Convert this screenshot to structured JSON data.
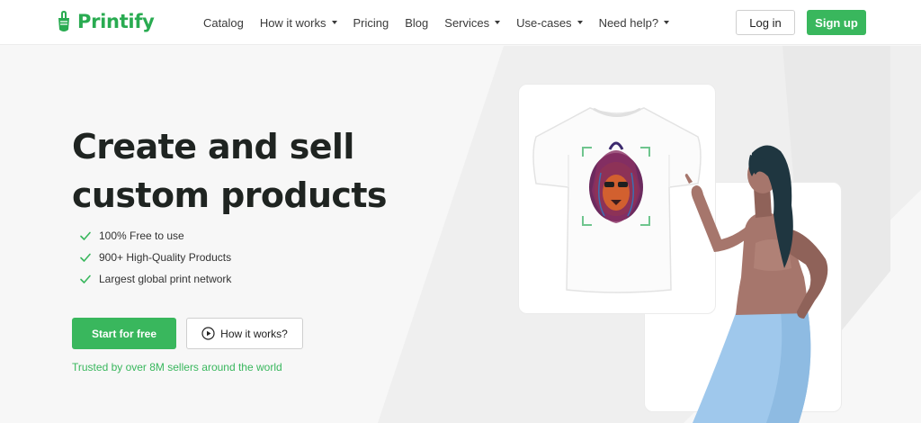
{
  "brand": {
    "name": "Printify",
    "color": "#29ab51"
  },
  "nav": {
    "items": [
      {
        "label": "Catalog",
        "dropdown": false
      },
      {
        "label": "How it works",
        "dropdown": true
      },
      {
        "label": "Pricing",
        "dropdown": false
      },
      {
        "label": "Blog",
        "dropdown": false
      },
      {
        "label": "Services",
        "dropdown": true
      },
      {
        "label": "Use-cases",
        "dropdown": true
      },
      {
        "label": "Need help?",
        "dropdown": true
      }
    ]
  },
  "auth": {
    "login_label": "Log in",
    "signup_label": "Sign up"
  },
  "hero": {
    "headline_line1": "Create and sell",
    "headline_line2": "custom products",
    "features": [
      "100% Free to use",
      "900+ High-Quality Products",
      "Largest global print network"
    ],
    "start_label": "Start for free",
    "how_label": "How it works?",
    "trusted_text": "Trusted by over 8M sellers around the world"
  },
  "colors": {
    "accent": "#39b75d",
    "text_dark": "#1f2421",
    "skirt": "#9fc8ec",
    "skin": "#a6766c",
    "hair": "#1f3640"
  },
  "icons": {
    "check": "check-icon",
    "play": "play-circle-icon",
    "logo": "printify-logo-icon"
  }
}
